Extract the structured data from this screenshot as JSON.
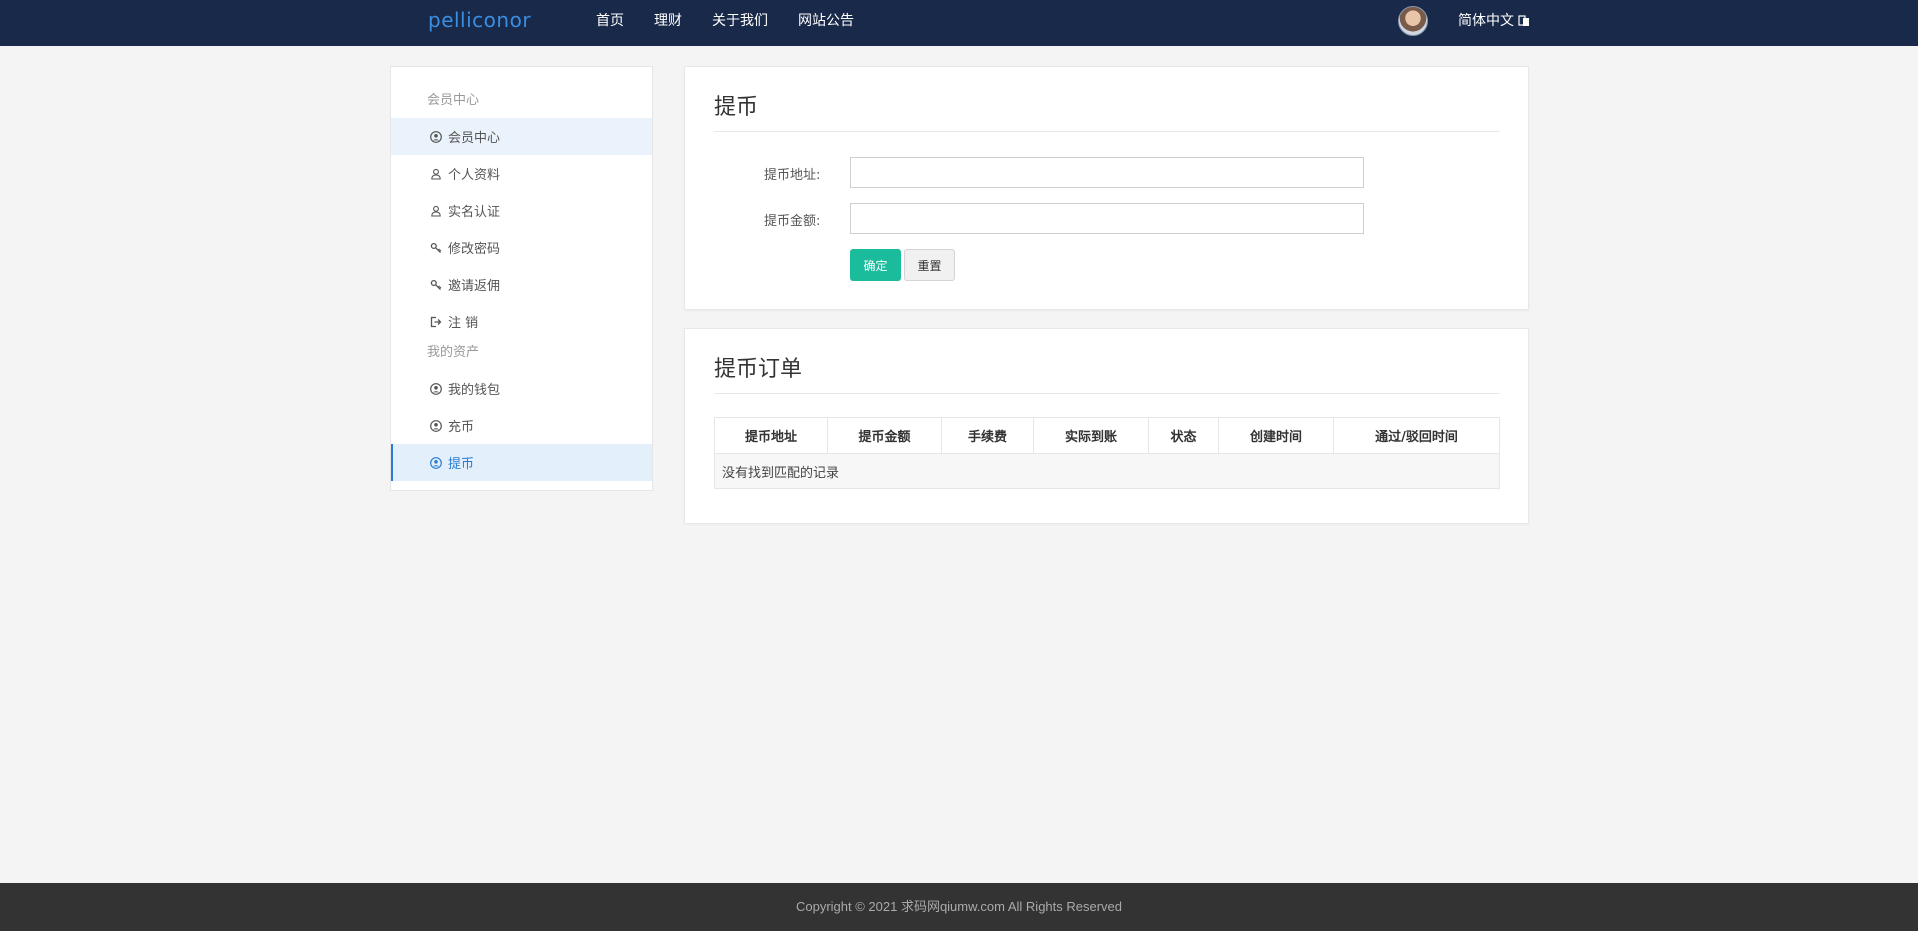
{
  "navbar": {
    "brand": "pelliconor",
    "links": [
      "首页",
      "理财",
      "关于我们",
      "网站公告"
    ],
    "language": "简体中文"
  },
  "sidebar": {
    "group_member": "会员中心",
    "member_items": [
      {
        "label": "会员中心",
        "icon": "user-circle-icon"
      },
      {
        "label": "个人资料",
        "icon": "user-outline-icon"
      },
      {
        "label": "实名认证",
        "icon": "user-outline-icon"
      },
      {
        "label": "修改密码",
        "icon": "key-icon"
      },
      {
        "label": "邀请返佣",
        "icon": "key-icon"
      },
      {
        "label": "注 销",
        "icon": "sign-out-icon"
      }
    ],
    "group_assets": "我的资产",
    "asset_items": [
      {
        "label": "我的钱包",
        "icon": "user-circle-icon"
      },
      {
        "label": "充币",
        "icon": "user-circle-icon"
      },
      {
        "label": "提币",
        "icon": "user-circle-icon"
      }
    ]
  },
  "withdraw_form": {
    "title": "提币",
    "address_label": "提币地址:",
    "address_value": "",
    "amount_label": "提币金额:",
    "amount_value": "",
    "confirm_label": "确定",
    "reset_label": "重置"
  },
  "orders": {
    "title": "提币订单",
    "columns": [
      "提币地址",
      "提币金额",
      "手续费",
      "实际到账",
      "状态",
      "创建时间",
      "通过/驳回时间"
    ],
    "empty_text": "没有找到匹配的记录"
  },
  "footer": {
    "copyright": "Copyright © 2021 求码网qiumw.com All Rights Reserved"
  },
  "colors": {
    "navbar_bg": "#19294a",
    "brand": "#3b8de0",
    "accent": "#2a7bd4",
    "confirm_button": "#1abc9c",
    "footer_bg": "#333333"
  }
}
